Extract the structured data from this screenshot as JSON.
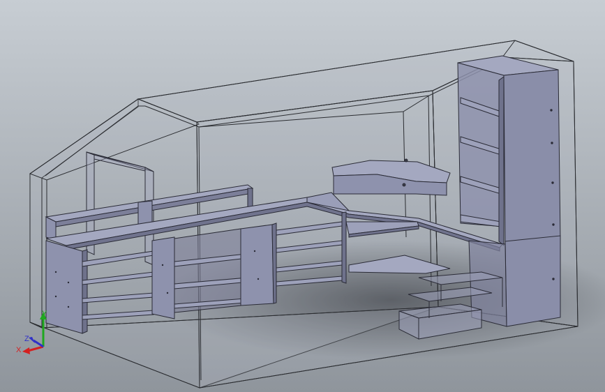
{
  "viewport": {
    "background_top": "#c7cdd3",
    "background_bottom": "#8f959c",
    "floor_shadow": "#5b5e63"
  },
  "model": {
    "enclosure_stroke": "#2a2c30",
    "enclosure_fill": "#b3b8c4",
    "panel_fill": "#8e92ad",
    "panel_fill_light": "#a4a8c0",
    "panel_fill_dark": "#6f728c",
    "panel_stroke": "#2a2b36"
  },
  "triad": {
    "x_label": "X",
    "y_label": "Y",
    "z_label": "Z",
    "x_color": "#d42020",
    "y_color": "#1fa81f",
    "z_color": "#3030c8"
  }
}
